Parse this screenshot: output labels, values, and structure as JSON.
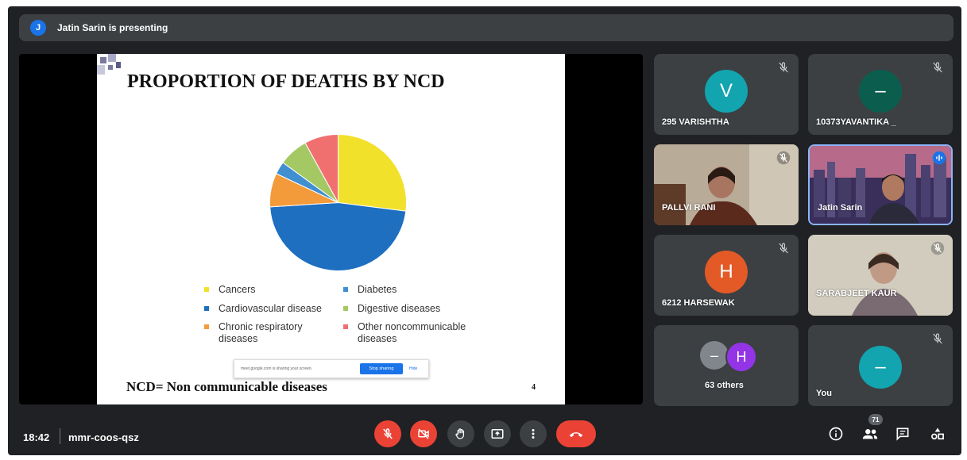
{
  "presenter_bar": {
    "avatar_initial": "J",
    "text": "Jatin Sarin is presenting"
  },
  "slide": {
    "title": "PROPORTION OF DEATHS BY NCD",
    "footer_note": "NCD= Non communicable diseases",
    "page_number": "4",
    "legend": [
      {
        "label": "Cancers",
        "color": "#f2e12a"
      },
      {
        "label": "Diabetes",
        "color": "#3f8fd1"
      },
      {
        "label": "Cardiovascular disease",
        "color": "#1e6fc0"
      },
      {
        "label": "Digestive diseases",
        "color": "#a4c864"
      },
      {
        "label": "Chronic respiratory diseases",
        "color": "#f39a3a"
      },
      {
        "label": "Other noncommunicable diseases",
        "color": "#f07070"
      }
    ],
    "share_bar": {
      "text": "meet.google.com is sharing your screen.",
      "stop_label": "Stop sharing",
      "hide_label": "Hide"
    }
  },
  "chart_data": {
    "type": "pie",
    "title": "PROPORTION OF DEATHS BY NCD",
    "slices": [
      {
        "label": "Cancers",
        "value": 27,
        "color": "#f2e12a"
      },
      {
        "label": "Cardiovascular disease",
        "value": 47,
        "color": "#1e6fc0"
      },
      {
        "label": "Chronic respiratory diseases",
        "value": 8,
        "color": "#f39a3a"
      },
      {
        "label": "Diabetes",
        "value": 3,
        "color": "#3f8fd1"
      },
      {
        "label": "Digestive diseases",
        "value": 7,
        "color": "#a4c864"
      },
      {
        "label": "Other noncommunicable diseases",
        "value": 8,
        "color": "#f07070"
      }
    ]
  },
  "participants": [
    {
      "name": "295 VARISHTHA",
      "initial": "V",
      "avatar_color": "#12a4af",
      "muted": true
    },
    {
      "name": "10373YAVANTIKA _",
      "initial": "–",
      "avatar_color": "#0b5e4e",
      "muted": true
    },
    {
      "name": "PALLVI RANI",
      "muted": true,
      "video": true
    },
    {
      "name": "Jatin Sarin",
      "speaking": true,
      "video": true
    },
    {
      "name": "6212 HARSEWAK",
      "initial": "H",
      "avatar_color": "#e45a27",
      "muted": true
    },
    {
      "name": "SARABJEET KAUR",
      "muted": true,
      "video": true
    },
    {
      "name": "63 others",
      "initials": [
        "–",
        "H"
      ]
    },
    {
      "name": "You",
      "initial": "–",
      "avatar_color": "#12a4af",
      "muted": true
    }
  ],
  "toolbar": {
    "time": "18:42",
    "meeting_code": "mmr-coos-qsz",
    "people_count": "71",
    "icons": [
      "mic-off-icon",
      "camera-off-icon",
      "raise-hand-icon",
      "present-screen-icon",
      "more-options-icon",
      "end-call-icon",
      "info-icon",
      "people-icon",
      "chat-icon",
      "activities-icon"
    ]
  }
}
